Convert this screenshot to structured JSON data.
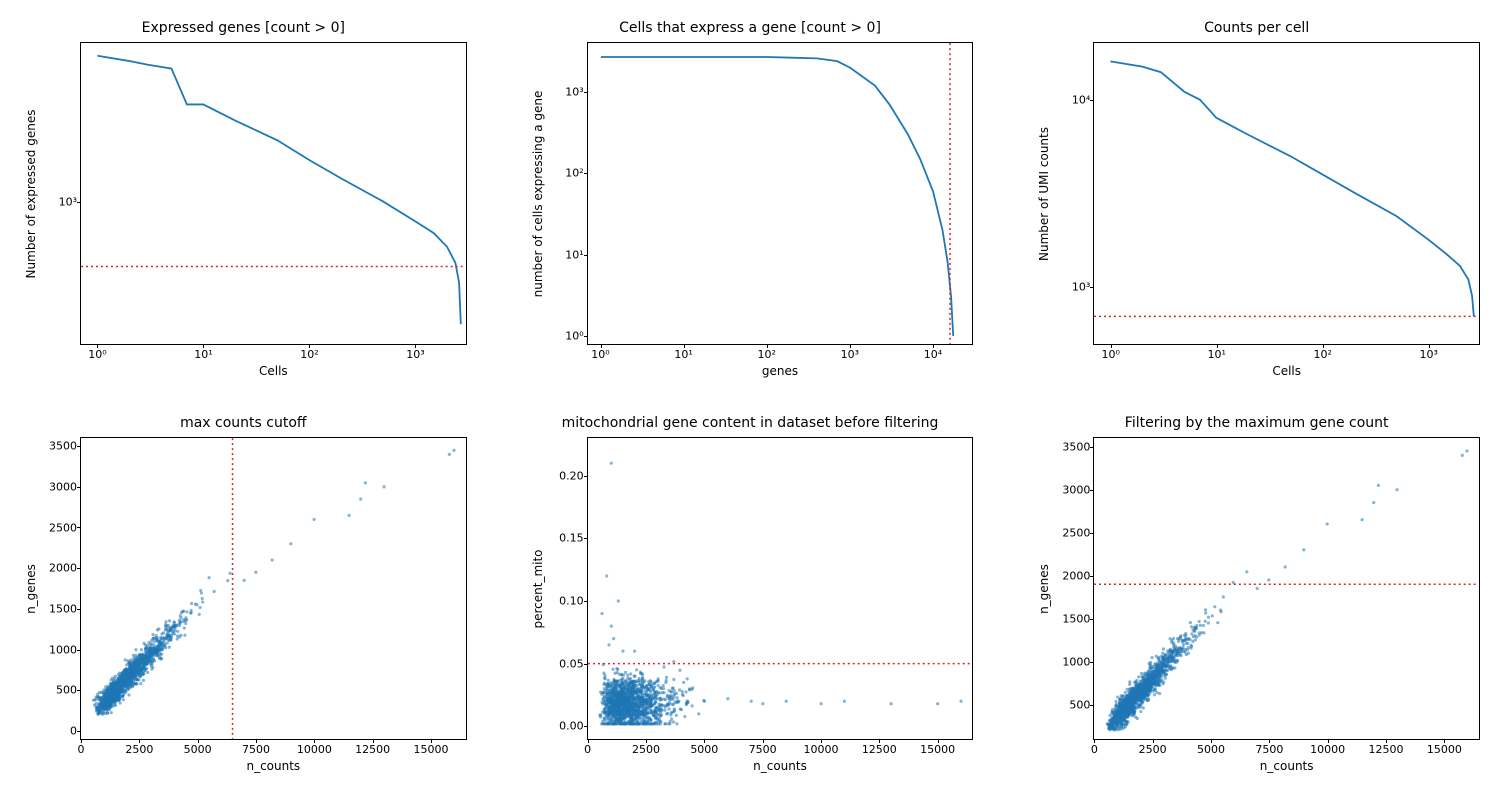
{
  "chart_data": [
    {
      "id": "p0",
      "type": "line",
      "title": "Expressed genes [count > 0]",
      "xlabel": "Cells",
      "ylabel": "Number of expressed genes",
      "xscale": "log",
      "yscale": "log",
      "xlim": [
        0.7,
        3000
      ],
      "ylim": [
        200,
        6000
      ],
      "xticks": [
        1,
        10,
        100,
        1000
      ],
      "xtick_labels": [
        "10⁰",
        "10¹",
        "10²",
        "10³"
      ],
      "yticks": [
        1000
      ],
      "ytick_labels": [
        "10³"
      ],
      "series": [
        {
          "name": "expressed",
          "x": [
            1,
            2,
            3,
            5,
            7,
            10,
            20,
            50,
            100,
            200,
            500,
            1000,
            1500,
            2000,
            2400,
            2600,
            2700
          ],
          "y": [
            5200,
            4900,
            4700,
            4500,
            3000,
            3000,
            2500,
            2000,
            1600,
            1300,
            1000,
            800,
            700,
            600,
            500,
            400,
            250
          ]
        }
      ],
      "hline": 480
    },
    {
      "id": "p1",
      "type": "line",
      "title": "Cells that express a gene [count > 0]",
      "xlabel": "genes",
      "ylabel": "number of cells expressing a gene",
      "xscale": "log",
      "yscale": "log",
      "xlim": [
        0.7,
        30000
      ],
      "ylim": [
        0.8,
        4000
      ],
      "xticks": [
        1,
        10,
        100,
        1000,
        10000
      ],
      "xtick_labels": [
        "10⁰",
        "10¹",
        "10²",
        "10³",
        "10⁴"
      ],
      "yticks": [
        1,
        10,
        100,
        1000
      ],
      "ytick_labels": [
        "10⁰",
        "10¹",
        "10²",
        "10³"
      ],
      "series": [
        {
          "name": "cellspergene",
          "x": [
            1,
            10,
            50,
            100,
            200,
            400,
            700,
            1000,
            2000,
            3000,
            5000,
            7000,
            10000,
            13000,
            15000,
            16500,
            17500
          ],
          "y": [
            2700,
            2700,
            2700,
            2700,
            2650,
            2600,
            2400,
            2000,
            1200,
            700,
            300,
            150,
            60,
            20,
            8,
            3,
            1
          ]
        }
      ],
      "vline": 16000
    },
    {
      "id": "p2",
      "type": "line",
      "title": "Counts per cell",
      "xlabel": "Cells",
      "ylabel": "Number of UMI counts",
      "xscale": "log",
      "yscale": "log",
      "xlim": [
        0.7,
        3000
      ],
      "ylim": [
        500,
        20000
      ],
      "xticks": [
        1,
        10,
        100,
        1000
      ],
      "xtick_labels": [
        "10⁰",
        "10¹",
        "10²",
        "10³"
      ],
      "yticks": [
        1000,
        10000
      ],
      "ytick_labels": [
        "10³",
        "10⁴"
      ],
      "series": [
        {
          "name": "umi",
          "x": [
            1,
            2,
            3,
            5,
            7,
            10,
            20,
            50,
            100,
            200,
            500,
            1000,
            1500,
            2000,
            2400,
            2600,
            2700
          ],
          "y": [
            16000,
            15000,
            14000,
            11000,
            10000,
            8000,
            6500,
            5000,
            4000,
            3200,
            2400,
            1800,
            1500,
            1300,
            1100,
            900,
            700
          ]
        }
      ],
      "hline": 700
    },
    {
      "id": "p3",
      "type": "scatter",
      "title": "max counts cutoff",
      "xlabel": "n_counts",
      "ylabel": "n_genes",
      "xscale": "linear",
      "yscale": "linear",
      "xlim": [
        0,
        16500
      ],
      "ylim": [
        -100,
        3600
      ],
      "xticks": [
        0,
        2500,
        5000,
        7500,
        10000,
        12500,
        15000
      ],
      "xtick_labels": [
        "0",
        "2500",
        "5000",
        "7500",
        "10000",
        "12500",
        "15000"
      ],
      "yticks": [
        0,
        500,
        1000,
        1500,
        2000,
        2500,
        3000,
        3500
      ],
      "ytick_labels": [
        "0",
        "500",
        "1000",
        "1500",
        "2000",
        "2500",
        "3000",
        "3500"
      ],
      "scatter_note": "dense cloud n_counts≈500-6000, n_genes≈250-1800, plus outliers up to (16000,3450)",
      "vline": 6500
    },
    {
      "id": "p4",
      "type": "scatter",
      "title": "mitochondrial gene content in dataset before filtering",
      "xlabel": "n_counts",
      "ylabel": "percent_mito",
      "xscale": "linear",
      "yscale": "linear",
      "xlim": [
        0,
        16500
      ],
      "ylim": [
        -0.01,
        0.23
      ],
      "xticks": [
        0,
        2500,
        5000,
        7500,
        10000,
        12500,
        15000
      ],
      "xtick_labels": [
        "0",
        "2500",
        "5000",
        "7500",
        "10000",
        "12500",
        "15000"
      ],
      "yticks": [
        0.0,
        0.05,
        0.1,
        0.15,
        0.2
      ],
      "ytick_labels": [
        "0.00",
        "0.05",
        "0.10",
        "0.15",
        "0.20"
      ],
      "scatter_note": "dense cloud n_counts≈500-4000, percent_mito≈0.00-0.04, sparse tail out to (16000,0.02), few outliers up to 0.21",
      "hline": 0.05
    },
    {
      "id": "p5",
      "type": "scatter",
      "title": "Filtering by the maximum gene count",
      "xlabel": "n_counts",
      "ylabel": "n_genes",
      "xscale": "linear",
      "yscale": "linear",
      "xlim": [
        0,
        16500
      ],
      "ylim": [
        100,
        3600
      ],
      "xticks": [
        0,
        2500,
        5000,
        7500,
        10000,
        12500,
        15000
      ],
      "xtick_labels": [
        "0",
        "2500",
        "5000",
        "7500",
        "10000",
        "12500",
        "15000"
      ],
      "yticks": [
        500,
        1000,
        1500,
        2000,
        2500,
        3000,
        3500
      ],
      "ytick_labels": [
        "500",
        "1000",
        "1500",
        "2000",
        "2500",
        "3000",
        "3500"
      ],
      "scatter_note": "dense cloud same as p3",
      "hline": 1900
    }
  ]
}
